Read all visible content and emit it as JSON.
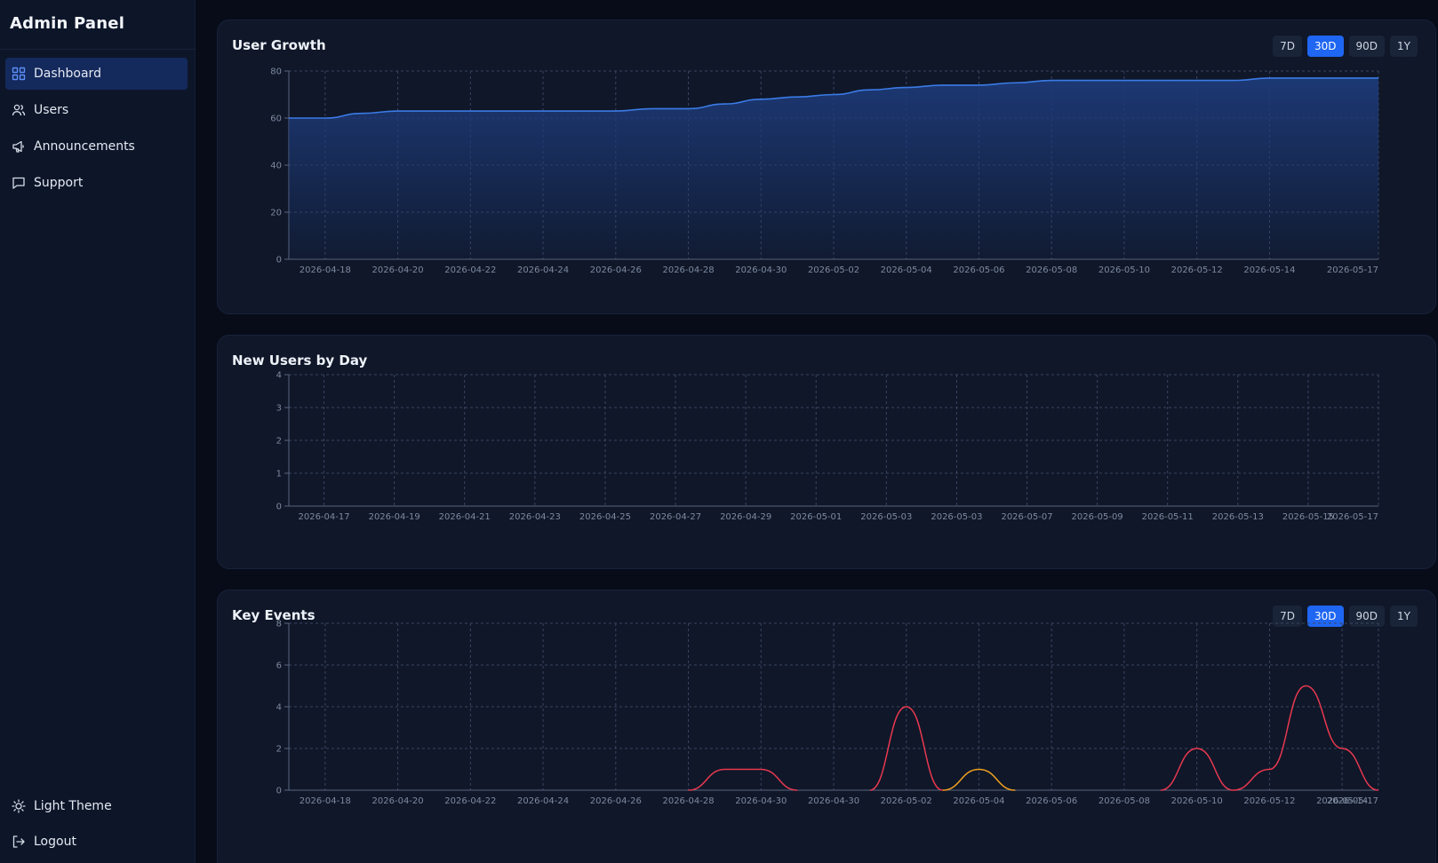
{
  "sidebar": {
    "title": "Admin Panel",
    "items": [
      {
        "label": "Dashboard",
        "icon": "dashboard-icon",
        "active": true
      },
      {
        "label": "Users",
        "icon": "users-icon",
        "active": false
      },
      {
        "label": "Announcements",
        "icon": "megaphone-icon",
        "active": false
      },
      {
        "label": "Support",
        "icon": "chat-icon",
        "active": false
      }
    ],
    "footer": [
      {
        "label": "Light Theme",
        "icon": "sun-icon"
      },
      {
        "label": "Logout",
        "icon": "logout-icon"
      }
    ]
  },
  "colors": {
    "accent": "#1f66f2",
    "line_blue": "#3b7be6",
    "area_blue": "#1d3a78",
    "event_red": "#e8384f",
    "event_orange": "#f0a020"
  },
  "range_options": [
    "7D",
    "30D",
    "90D",
    "1Y"
  ],
  "range_selected": "30D",
  "cards": {
    "growth": {
      "title": "User Growth"
    },
    "new_users": {
      "title": "New Users by Day"
    },
    "events": {
      "title": "Key Events"
    }
  },
  "chart_data": [
    {
      "type": "area",
      "title": "User Growth",
      "x_tick_labels": [
        "2026-04-18",
        "2026-04-20",
        "2026-04-22",
        "2026-04-24",
        "2026-04-26",
        "2026-04-28",
        "2026-04-30",
        "2026-05-02",
        "2026-05-04",
        "2026-05-06",
        "2026-05-08",
        "2026-05-10",
        "2026-05-12",
        "2026-05-14",
        "2026-05-17"
      ],
      "x": [
        "2026-04-17",
        "2026-04-18",
        "2026-04-19",
        "2026-04-20",
        "2026-04-21",
        "2026-04-22",
        "2026-04-23",
        "2026-04-24",
        "2026-04-25",
        "2026-04-26",
        "2026-04-27",
        "2026-04-28",
        "2026-04-29",
        "2026-04-30",
        "2026-05-01",
        "2026-05-02",
        "2026-05-03",
        "2026-05-04",
        "2026-05-05",
        "2026-05-06",
        "2026-05-07",
        "2026-05-08",
        "2026-05-09",
        "2026-05-10",
        "2026-05-11",
        "2026-05-12",
        "2026-05-13",
        "2026-05-14",
        "2026-05-15",
        "2026-05-16",
        "2026-05-17"
      ],
      "values": [
        60,
        60,
        62,
        63,
        63,
        63,
        63,
        63,
        63,
        63,
        64,
        64,
        66,
        68,
        69,
        70,
        72,
        73,
        74,
        74,
        75,
        76,
        76,
        76,
        76,
        76,
        76,
        77,
        77,
        77,
        77
      ],
      "ylim": [
        0,
        80
      ],
      "y_ticks": [
        0,
        20,
        40,
        60,
        80
      ],
      "grid": true
    },
    {
      "type": "bar",
      "title": "New Users by Day",
      "x_tick_labels": [
        "2026-04-17",
        "2026-04-19",
        "2026-04-21",
        "2026-04-23",
        "2026-04-25",
        "2026-04-27",
        "2026-04-29",
        "2026-05-01",
        "2026-05-03",
        "2026-05-03",
        "2026-05-07",
        "2026-05-09",
        "2026-05-11",
        "2026-05-13",
        "2026-05-15",
        "2026-05-17"
      ],
      "values": [],
      "ylim": [
        0,
        4
      ],
      "y_ticks": [
        0,
        1,
        2,
        3,
        4
      ],
      "grid": true
    },
    {
      "type": "line",
      "title": "Key Events",
      "x_tick_labels": [
        "2026-04-18",
        "2026-04-20",
        "2026-04-22",
        "2026-04-24",
        "2026-04-26",
        "2026-04-28",
        "2026-04-30",
        "2026-04-30",
        "2026-05-02",
        "2026-05-04",
        "2026-05-06",
        "2026-05-08",
        "2026-05-10",
        "2026-05-12",
        "2026-05-14",
        "2026-05-17"
      ],
      "x": [
        "2026-04-17",
        "2026-04-18",
        "2026-04-19",
        "2026-04-20",
        "2026-04-21",
        "2026-04-22",
        "2026-04-23",
        "2026-04-24",
        "2026-04-25",
        "2026-04-26",
        "2026-04-27",
        "2026-04-28",
        "2026-04-29",
        "2026-04-30",
        "2026-05-01",
        "2026-05-02",
        "2026-05-03",
        "2026-05-04",
        "2026-05-05",
        "2026-05-06",
        "2026-05-07",
        "2026-05-08",
        "2026-05-09",
        "2026-05-10",
        "2026-05-11",
        "2026-05-12",
        "2026-05-13",
        "2026-05-14",
        "2026-05-15",
        "2026-05-16",
        "2026-05-17"
      ],
      "series": [
        {
          "color": "#e8384f",
          "values": [
            0,
            0,
            0,
            0,
            0,
            0,
            0,
            0,
            0,
            0,
            0,
            0,
            1,
            1,
            0,
            0,
            0,
            4,
            0,
            0,
            0,
            0,
            0,
            0,
            0,
            2,
            0,
            1,
            5,
            2,
            0
          ]
        },
        {
          "color": "#f0a020",
          "values": [
            0,
            0,
            0,
            0,
            0,
            0,
            0,
            0,
            0,
            0,
            0,
            0,
            0,
            0,
            0,
            0,
            0,
            0,
            0,
            1,
            0,
            0,
            0,
            0,
            0,
            0,
            0,
            0,
            0,
            0,
            0
          ]
        }
      ],
      "ylim": [
        0,
        8
      ],
      "y_ticks": [
        0,
        2,
        4,
        6,
        8
      ],
      "grid": true
    }
  ]
}
